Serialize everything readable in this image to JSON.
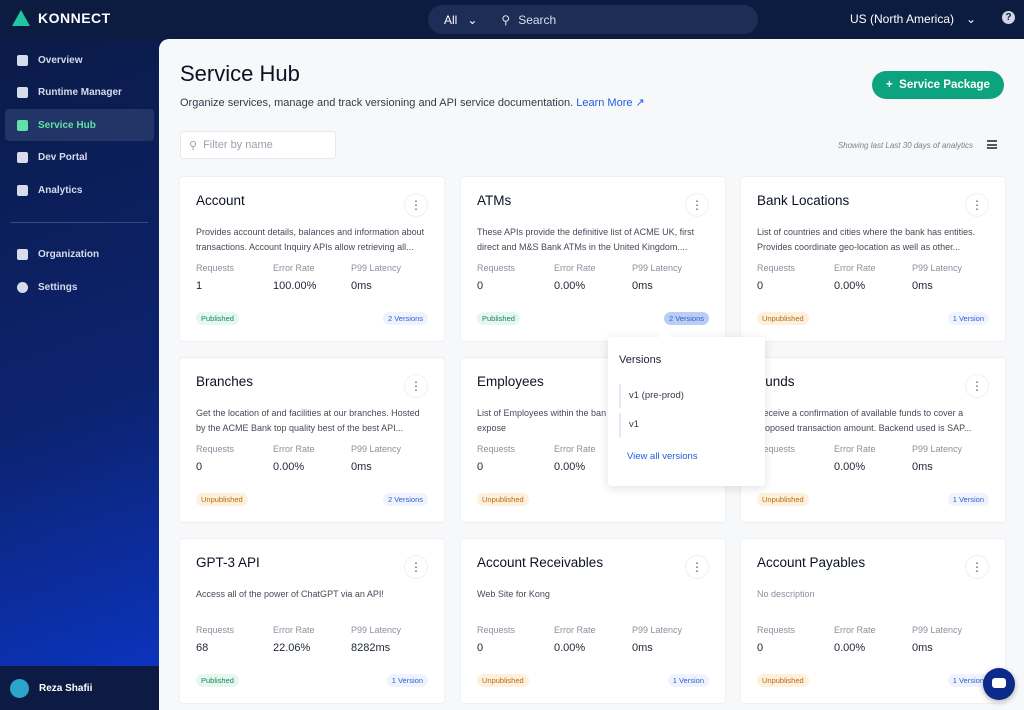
{
  "topbar": {
    "brand": "KONNECT",
    "search_scope": "All",
    "search_placeholder": "Search",
    "region": "US (North America)",
    "help": "?"
  },
  "sidebar": {
    "items": [
      {
        "label": "Overview",
        "icon": "overview-icon"
      },
      {
        "label": "Runtime Manager",
        "icon": "runtime-icon"
      },
      {
        "label": "Service Hub",
        "icon": "service-hub-icon",
        "active": true
      },
      {
        "label": "Dev Portal",
        "icon": "dev-portal-icon"
      },
      {
        "label": "Analytics",
        "icon": "analytics-icon"
      },
      {
        "label": "Organization",
        "icon": "organization-icon"
      },
      {
        "label": "Settings",
        "icon": "settings-icon"
      }
    ],
    "user": "Reza Shafii"
  },
  "main": {
    "title": "Service Hub",
    "subtitle": "Organize services, manage and track versioning and API service documentation.",
    "learn_more": "Learn More",
    "new_button": "Service Package",
    "filter_placeholder": "Filter by name",
    "showing": "Showing last Last 30 days of analytics",
    "stat_labels": {
      "requests": "Requests",
      "error_rate": "Error Rate",
      "latency": "P99 Latency"
    },
    "cards": [
      {
        "name": "Account",
        "desc": "Provides account details, balances and information about transactions. Account Inquiry APIs allow retrieving all...",
        "requests": "1",
        "error_rate": "100.00%",
        "latency": "0ms",
        "status": "Published",
        "versions": "2 Versions"
      },
      {
        "name": "ATMs",
        "desc": "These APIs provide the definitive list of ACME UK, first direct and M&S Bank ATMs in the United Kingdom....",
        "requests": "0",
        "error_rate": "0.00%",
        "latency": "0ms",
        "status": "Published",
        "versions": "2 Versions"
      },
      {
        "name": "Bank Locations",
        "desc": "List of countries and cities where the bank has entities. Provides coordinate geo-location as well as other...",
        "requests": "0",
        "error_rate": "0.00%",
        "latency": "0ms",
        "status": "Unpublished",
        "versions": "1 Version"
      },
      {
        "name": "Branches",
        "desc": "Get the location of and facilities at our branches. Hosted by the ACME Bank top quality best of the best API...",
        "requests": "0",
        "error_rate": "0.00%",
        "latency": "0ms",
        "status": "Unpublished",
        "versions": "2 Versions"
      },
      {
        "name": "Employees",
        "desc": "List of Employees within the ban only and should never be expose",
        "requests": "0",
        "error_rate": "0.00%",
        "latency": "",
        "status": "Unpublished",
        "versions": ""
      },
      {
        "name": "Funds",
        "desc": "Receive a confirmation of available funds to cover a proposed transaction amount. Backend used is SAP...",
        "requests": "0",
        "error_rate": "0.00%",
        "latency": "0ms",
        "status": "Unpublished",
        "versions": "1 Version"
      },
      {
        "name": "GPT-3 API",
        "desc": "Access all of the power of ChatGPT via an API!",
        "requests": "68",
        "error_rate": "22.06%",
        "latency": "8282ms",
        "status": "Published",
        "versions": "1 Version"
      },
      {
        "name": "Account Receivables",
        "desc": "Web Site for Kong",
        "requests": "0",
        "error_rate": "0.00%",
        "latency": "0ms",
        "status": "Unpublished",
        "versions": "1 Version"
      },
      {
        "name": "Account Payables",
        "desc": "No description",
        "requests": "0",
        "error_rate": "0.00%",
        "latency": "0ms",
        "status": "Unpublished",
        "versions": "1 Version"
      }
    ],
    "popover": {
      "title": "Versions",
      "items": [
        "v1 (pre-prod)",
        "v1"
      ],
      "link": "View all versions"
    }
  },
  "colors": {
    "accent": "#0ea37f",
    "link": "#1f5de0",
    "sidebar_active": "#5fe0a8"
  }
}
